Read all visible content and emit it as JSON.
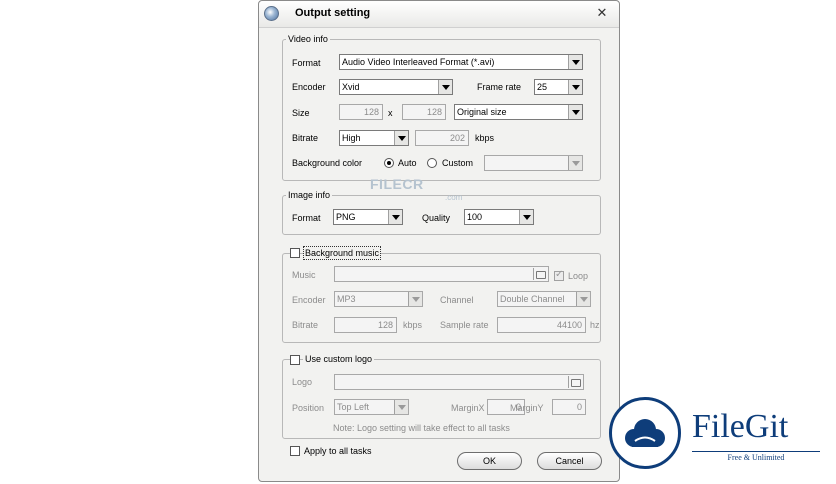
{
  "dialog": {
    "title": "Output setting",
    "close_icon": "close-icon"
  },
  "video_info": {
    "group_label": "Video info",
    "format_label": "Format",
    "format_value": "Audio Video Interleaved Format (*.avi)",
    "encoder_label": "Encoder",
    "encoder_value": "Xvid",
    "frame_rate_label": "Frame rate",
    "frame_rate_value": "25",
    "size_label": "Size",
    "width_value": "128",
    "size_x": "x",
    "height_value": "128",
    "size_preset_value": "Original size",
    "bitrate_label": "Bitrate",
    "bitrate_value": "High",
    "bitrate_number": "202",
    "bitrate_unit": "kbps",
    "bg_color_label": "Background color",
    "bg_auto_label": "Auto",
    "bg_custom_label": "Custom",
    "bg_color_value": ""
  },
  "image_info": {
    "group_label": "Image info",
    "format_label": "Format",
    "format_value": "PNG",
    "quality_label": "Quality",
    "quality_value": "100"
  },
  "background_music": {
    "group_label": "Background music",
    "music_label": "Music",
    "music_value": "",
    "loop_label": "Loop",
    "encoder_label": "Encoder",
    "encoder_value": "MP3",
    "channel_label": "Channel",
    "channel_value": "Double Channel",
    "bitrate_label": "Bitrate",
    "bitrate_value": "128",
    "bitrate_unit": "kbps",
    "sample_rate_label": "Sample rate",
    "sample_rate_value": "44100",
    "sample_rate_unit": "hz"
  },
  "custom_logo": {
    "group_label": "Use custom logo",
    "logo_label": "Logo",
    "logo_value": "",
    "position_label": "Position",
    "position_value": "Top Left",
    "margin_x_label": "MarginX",
    "margin_x_value": "0",
    "margin_y_label": "MarginY",
    "margin_y_value": "0",
    "note": "Note: Logo setting will take effect to all tasks"
  },
  "footer": {
    "apply_all_label": "Apply to all tasks",
    "ok_label": "OK",
    "cancel_label": "Cancel"
  },
  "watermarks": {
    "filecr_text": "FILECR",
    "filecr_sub": ".com",
    "filegit_name": "FileGit",
    "filegit_tag": "Free & Unlimited"
  },
  "colors": {
    "brand_blue": "#0e3d7a",
    "dialog_bg": "#f2f2f0"
  }
}
